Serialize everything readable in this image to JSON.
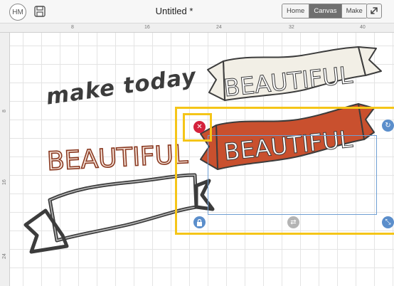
{
  "toolbar": {
    "avatar_initials": "HM",
    "save_icon": "save-icon",
    "title": "Untitled *",
    "modes": [
      {
        "label": "Home",
        "active": false
      },
      {
        "label": "Canvas",
        "active": true
      },
      {
        "label": "Make",
        "active": false
      }
    ],
    "fullscreen_icon": "expand-icon"
  },
  "rulers": {
    "top": [
      "8",
      "16",
      "24",
      "32",
      "40"
    ],
    "left": [
      "8",
      "16",
      "24"
    ]
  },
  "canvas": {
    "layers": {
      "make_today": "make today",
      "beautiful_brown": "BEAUTIFUL",
      "banner_top_text": "BEAUTIFUL",
      "banner_selected_text": "BEAUTIFUL"
    },
    "colors": {
      "selection_highlight": "#f5c518",
      "delete_handle": "#d4213b",
      "blue_handles": "#5b8ecb",
      "banner_cream": "#f2efe6",
      "banner_rust": "#c9502e",
      "outline_dark": "#3c3c3c"
    },
    "handles": {
      "delete": "close-icon",
      "rotate": "rotate-icon",
      "lock": "lock-icon",
      "resize": "resize-icon",
      "flip": "flip-icon"
    }
  }
}
